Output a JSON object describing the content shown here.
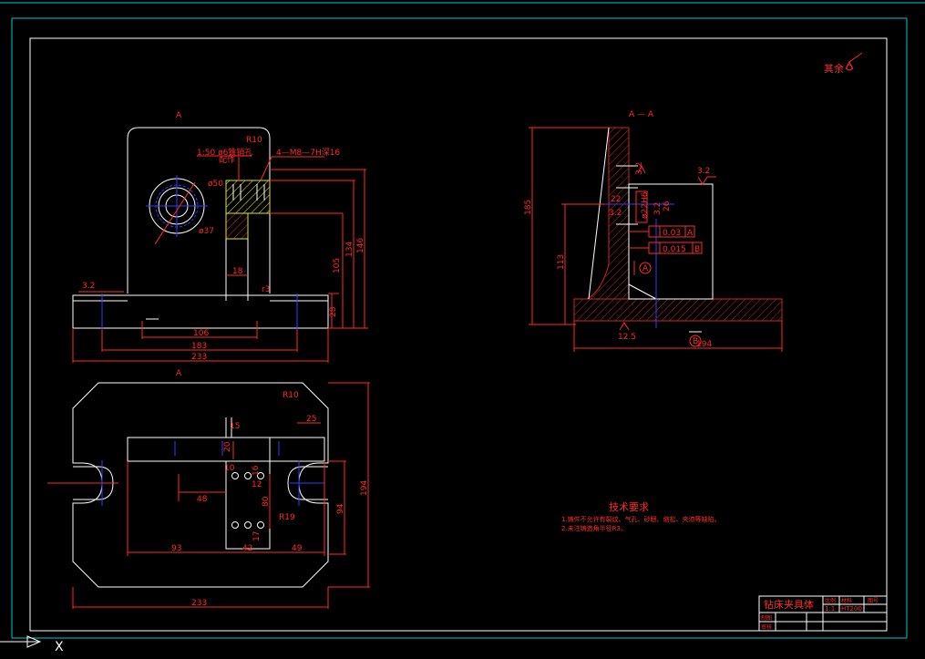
{
  "drawing": {
    "roughness_note": "其余",
    "section_title": "A — A",
    "view_markers": {
      "front_top": "A",
      "plan_top": "A"
    },
    "front_view": {
      "radius_label": "R10",
      "taper_note": "1:50  ø6锥销孔",
      "taper_note_sub": "配作",
      "thread_note": "4—M8—7H深16",
      "dia_50": "ø50",
      "dia_37": "ø37",
      "roughness": "3.2",
      "dim_18": "18",
      "dim_r3": "r3",
      "dim_105": "105",
      "dim_28": "28",
      "dim_134": "134",
      "dim_146": "146",
      "dim_106": "106",
      "dim_183": "183",
      "dim_233": "233"
    },
    "plan_view": {
      "radius_label": "R10",
      "dim_15": "15",
      "dim_25": "25",
      "dim_20": "20",
      "dim_16": "16",
      "dim_10": "10",
      "dim_12": "12",
      "dim_48": "48",
      "dim_80": "80",
      "dim_r19": "R19",
      "dim_94": "94",
      "dim_194": "194",
      "dim_17": "17",
      "dim_93": "93",
      "dim_42": "42",
      "dim_49": "49",
      "dim_233": "233"
    },
    "section_view": {
      "dim_185": "185",
      "dim_113": "113",
      "roughness_a": "3.2",
      "roughness_b": "3.2",
      "roughness_c": "3.2",
      "dim_22": "22",
      "dim_2h6": "ø22H6",
      "dim_3_2": "3.2",
      "dim_26": "26",
      "tol_1": "0.03",
      "datum_1": "A",
      "tol_2": "0.015",
      "datum_2": "B",
      "datum_a": "A",
      "datum_b": "B",
      "dim_12_5": "12.5",
      "dim_194": "194"
    },
    "tech_requirements": {
      "title": "技术要求",
      "line1": "1.铸件不允许有裂纹、气孔、砂眼、缩松、夹渣等缺陷。",
      "line2": "2.未注铸造角半径R3。"
    },
    "title_block": {
      "name": "钻床夹具体",
      "ratio_label": "比例",
      "material_label": "材料",
      "drawing_no_label": "图号",
      "ratio": "1:1",
      "material": "HT200",
      "drawn_label": "制图",
      "checked_label": "审核"
    }
  },
  "colors": {
    "background": "#000000",
    "border_cyan": "#00c8d2",
    "frame_white": "#ffffff",
    "dimension_red": "#ff2a2a",
    "center_blue": "#3a3aff",
    "hatch_red": "#c82828",
    "yellow": "#e8e800"
  },
  "ucs_icon": "ucs-axis-icon",
  "x_label": "X"
}
